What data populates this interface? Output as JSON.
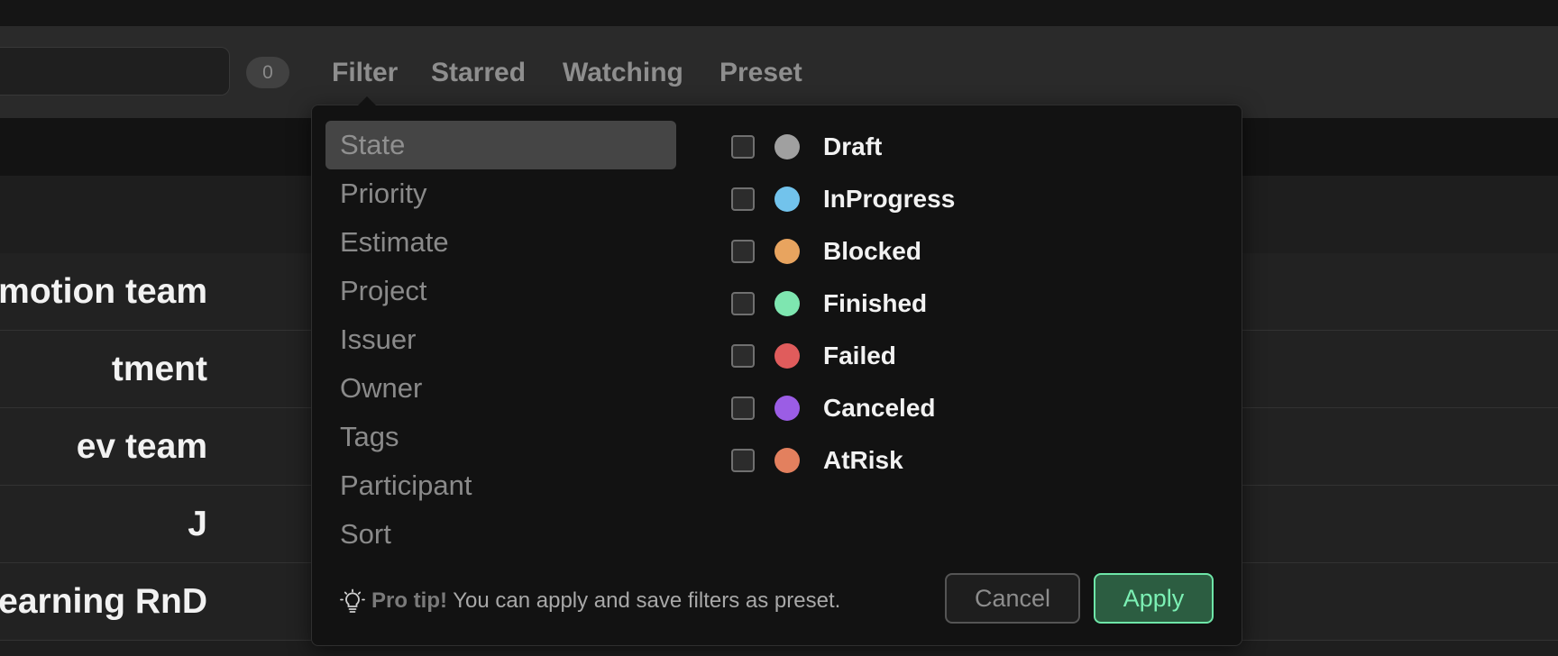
{
  "toolbar": {
    "search_count": "0",
    "tabs": [
      {
        "label": "Filter"
      },
      {
        "label": "Starred"
      },
      {
        "label": "Watching"
      },
      {
        "label": "Preset"
      }
    ]
  },
  "rows": [
    {
      "label": "omotion team"
    },
    {
      "label": "tment"
    },
    {
      "label": "ev team"
    },
    {
      "label": "J"
    },
    {
      "label": "Learning RnD"
    }
  ],
  "filter_panel": {
    "categories": [
      {
        "label": "State",
        "active": true
      },
      {
        "label": "Priority"
      },
      {
        "label": "Estimate"
      },
      {
        "label": "Project"
      },
      {
        "label": "Issuer"
      },
      {
        "label": "Owner"
      },
      {
        "label": "Tags"
      },
      {
        "label": "Participant"
      },
      {
        "label": "Sort"
      }
    ],
    "state_options": [
      {
        "label": "Draft",
        "color": "#a0a0a0",
        "checked": false
      },
      {
        "label": "InProgress",
        "color": "#72c3ec",
        "checked": false
      },
      {
        "label": "Blocked",
        "color": "#e8a45f",
        "checked": false
      },
      {
        "label": "Finished",
        "color": "#7ee6b0",
        "checked": false
      },
      {
        "label": "Failed",
        "color": "#e05c5c",
        "checked": false
      },
      {
        "label": "Canceled",
        "color": "#9b5de5",
        "checked": false
      },
      {
        "label": "AtRisk",
        "color": "#e3805e",
        "checked": false
      }
    ],
    "tip": {
      "icon": "lightbulb-icon",
      "strong": "Pro tip!",
      "text": " You can apply and save filters as preset."
    },
    "cancel_label": "Cancel",
    "apply_label": "Apply"
  }
}
